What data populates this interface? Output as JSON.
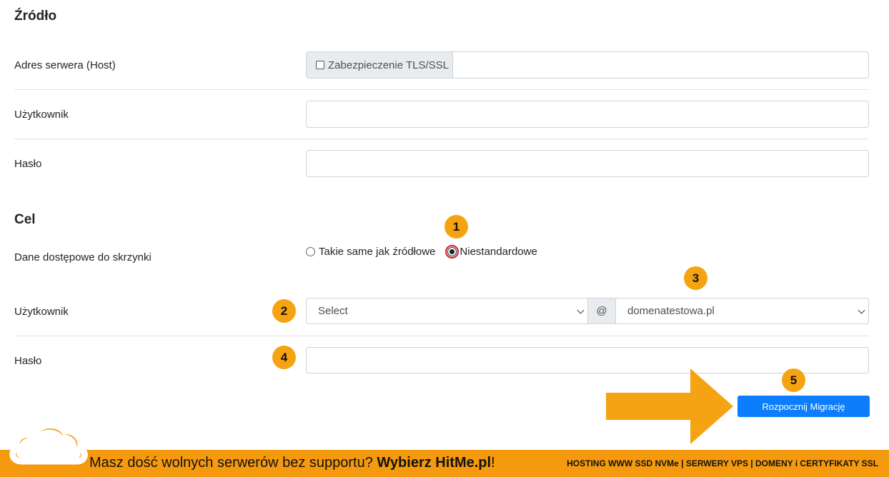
{
  "source": {
    "heading": "Źródło",
    "host_label": "Adres serwera (Host)",
    "tls_label": "Zabezpieczenie TLS/SSL",
    "host_value": "",
    "user_label": "Użytkownik",
    "user_value": "",
    "password_label": "Hasło",
    "password_value": ""
  },
  "target": {
    "heading": "Cel",
    "access_label": "Dane dostępowe do skrzynki",
    "radio_same": "Takie same jak źródłowe",
    "radio_custom": "Niestandardowe",
    "selected_radio": "custom",
    "user_label": "Użytkownik",
    "user_select_value": "Select",
    "at_sign": "@",
    "domain_select_value": "domenatestowa.pl",
    "password_label": "Hasło",
    "password_value": "",
    "submit_label": "Rozpocznij Migrację"
  },
  "annotations": {
    "badges": [
      "1",
      "2",
      "3",
      "4",
      "5"
    ],
    "accent_color": "#f5a312",
    "highlight_color": "#d8192a"
  },
  "banner": {
    "text_prefix": "Masz dość wolnych serwerów bez supportu? ",
    "text_brand": "Wybierz HitMe.pl",
    "text_suffix": "!",
    "right_text": "HOSTING WWW SSD NVMe | SERWERY VPS | DOMENY i CERTYFIKATY SSL",
    "color": "#f59a0e"
  },
  "colors": {
    "primary": "#0b7dfd"
  }
}
